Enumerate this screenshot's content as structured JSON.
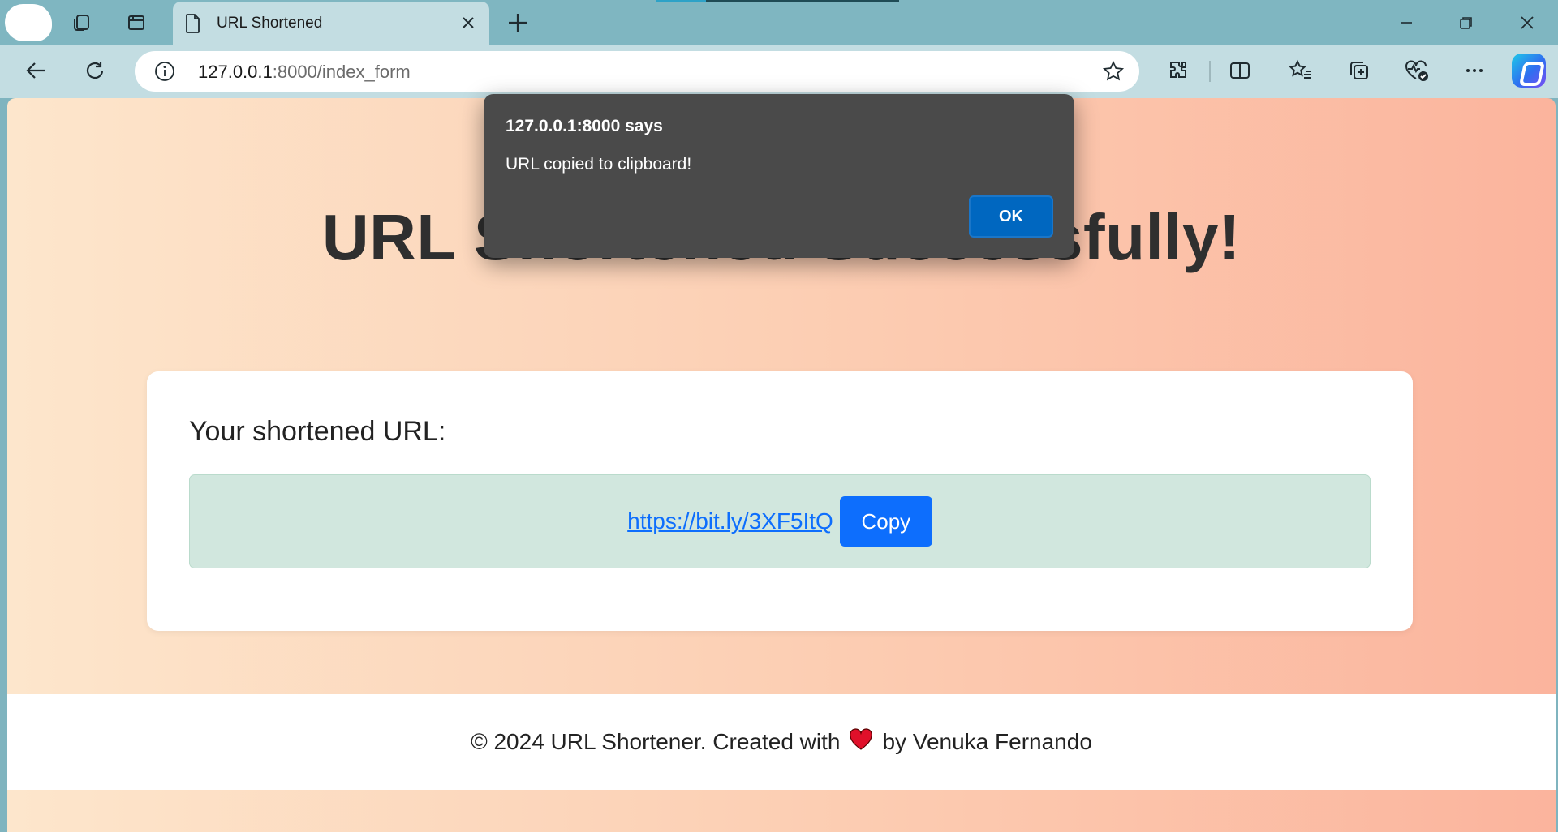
{
  "browser": {
    "tab": {
      "title": "URL Shortened",
      "icon": "document-icon"
    },
    "address": {
      "host": "127.0.0.1",
      "path": ":8000/index_form"
    },
    "icons": {
      "workspaces": "workspaces-icon",
      "tab_actions": "tab-actions-icon",
      "new_tab": "plus-icon",
      "back": "back-arrow-icon",
      "refresh": "refresh-icon",
      "info": "info-icon",
      "favorite": "star-icon",
      "extensions": "puzzle-icon",
      "split_screen": "split-screen-icon",
      "favorites": "favorites-icon",
      "collections": "collections-icon",
      "browser_essentials": "heart-pulse-icon",
      "more": "ellipsis-icon",
      "copilot": "copilot-icon"
    }
  },
  "page": {
    "heading": "URL Shortened Successfully!",
    "card_label": "Your shortened URL:",
    "short_url": "https://bit.ly/3XF5ItQ",
    "copy_label": "Copy",
    "footer": {
      "before": "© 2024 URL Shortener. Created with",
      "after": "by Venuka Fernando"
    }
  },
  "dialog": {
    "origin": "127.0.0.1:8000 says",
    "message": "URL copied to clipboard!",
    "ok_label": "OK"
  },
  "colors": {
    "accent": "#0d6efd",
    "dialog_bg": "#4a4a4a",
    "ok_button": "#0067c0",
    "heart": "#e0102a"
  }
}
